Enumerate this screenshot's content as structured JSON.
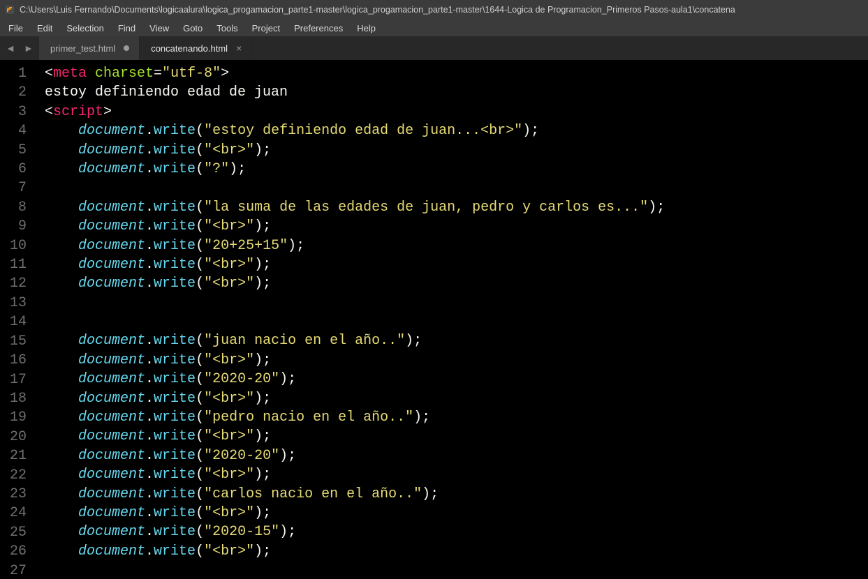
{
  "title_bar": {
    "path": "C:\\Users\\Luis Fernando\\Documents\\logicaalura\\logica_progamacion_parte1-master\\logica_progamacion_parte1-master\\1644-Logica de Programacion_Primeros Pasos-aula1\\concatena"
  },
  "menu": [
    "File",
    "Edit",
    "Selection",
    "Find",
    "View",
    "Goto",
    "Tools",
    "Project",
    "Preferences",
    "Help"
  ],
  "nav": {
    "back": "◄",
    "forward": "►"
  },
  "tabs": [
    {
      "label": "primer_test.html",
      "dirty": true,
      "active": false
    },
    {
      "label": "concatenando.html",
      "dirty": false,
      "active": true
    }
  ],
  "code_lines": [
    {
      "n": 1,
      "indent": 0,
      "segs": [
        {
          "t": "<",
          "c": "angle"
        },
        {
          "t": "meta ",
          "c": "tag"
        },
        {
          "t": "charset",
          "c": "attr"
        },
        {
          "t": "=",
          "c": "punct"
        },
        {
          "t": "\"utf-8\"",
          "c": "str"
        },
        {
          "t": ">",
          "c": "angle"
        }
      ]
    },
    {
      "n": 2,
      "indent": 0,
      "segs": [
        {
          "t": "estoy definiendo edad de juan",
          "c": "plain"
        }
      ]
    },
    {
      "n": 3,
      "indent": 0,
      "segs": [
        {
          "t": "<",
          "c": "angle"
        },
        {
          "t": "script",
          "c": "tag"
        },
        {
          "t": ">",
          "c": "angle"
        }
      ]
    },
    {
      "n": 4,
      "indent": 1,
      "segs": [
        {
          "t": "document",
          "c": "obj"
        },
        {
          "t": ".",
          "c": "dot"
        },
        {
          "t": "write",
          "c": "method"
        },
        {
          "t": "(",
          "c": "punct"
        },
        {
          "t": "\"estoy definiendo edad de juan...<br>\"",
          "c": "str"
        },
        {
          "t": ")",
          "c": "punct"
        },
        {
          "t": ";",
          "c": "semi"
        }
      ]
    },
    {
      "n": 5,
      "indent": 1,
      "segs": [
        {
          "t": "document",
          "c": "obj"
        },
        {
          "t": ".",
          "c": "dot"
        },
        {
          "t": "write",
          "c": "method"
        },
        {
          "t": "(",
          "c": "punct"
        },
        {
          "t": "\"<br>\"",
          "c": "str"
        },
        {
          "t": ")",
          "c": "punct"
        },
        {
          "t": ";",
          "c": "semi"
        }
      ]
    },
    {
      "n": 6,
      "indent": 1,
      "segs": [
        {
          "t": "document",
          "c": "obj"
        },
        {
          "t": ".",
          "c": "dot"
        },
        {
          "t": "write",
          "c": "method"
        },
        {
          "t": "(",
          "c": "punct"
        },
        {
          "t": "\"?\"",
          "c": "str"
        },
        {
          "t": ")",
          "c": "punct"
        },
        {
          "t": ";",
          "c": "semi"
        }
      ]
    },
    {
      "n": 7,
      "indent": 1,
      "segs": []
    },
    {
      "n": 8,
      "indent": 1,
      "segs": [
        {
          "t": "document",
          "c": "obj"
        },
        {
          "t": ".",
          "c": "dot"
        },
        {
          "t": "write",
          "c": "method"
        },
        {
          "t": "(",
          "c": "punct"
        },
        {
          "t": "\"la suma de las edades de juan, pedro y carlos es...\"",
          "c": "str"
        },
        {
          "t": ")",
          "c": "punct"
        },
        {
          "t": ";",
          "c": "semi"
        }
      ]
    },
    {
      "n": 9,
      "indent": 1,
      "segs": [
        {
          "t": "document",
          "c": "obj"
        },
        {
          "t": ".",
          "c": "dot"
        },
        {
          "t": "write",
          "c": "method"
        },
        {
          "t": "(",
          "c": "punct"
        },
        {
          "t": "\"<br>\"",
          "c": "str"
        },
        {
          "t": ")",
          "c": "punct"
        },
        {
          "t": ";",
          "c": "semi"
        }
      ]
    },
    {
      "n": 10,
      "indent": 1,
      "segs": [
        {
          "t": "document",
          "c": "obj"
        },
        {
          "t": ".",
          "c": "dot"
        },
        {
          "t": "write",
          "c": "method"
        },
        {
          "t": "(",
          "c": "punct"
        },
        {
          "t": "\"20+25+15\"",
          "c": "str"
        },
        {
          "t": ")",
          "c": "punct"
        },
        {
          "t": ";",
          "c": "semi"
        }
      ]
    },
    {
      "n": 11,
      "indent": 1,
      "segs": [
        {
          "t": "document",
          "c": "obj"
        },
        {
          "t": ".",
          "c": "dot"
        },
        {
          "t": "write",
          "c": "method"
        },
        {
          "t": "(",
          "c": "punct"
        },
        {
          "t": "\"<br>\"",
          "c": "str"
        },
        {
          "t": ")",
          "c": "punct"
        },
        {
          "t": ";",
          "c": "semi"
        }
      ]
    },
    {
      "n": 12,
      "indent": 1,
      "segs": [
        {
          "t": "document",
          "c": "obj"
        },
        {
          "t": ".",
          "c": "dot"
        },
        {
          "t": "write",
          "c": "method"
        },
        {
          "t": "(",
          "c": "punct"
        },
        {
          "t": "\"<br>\"",
          "c": "str"
        },
        {
          "t": ")",
          "c": "punct"
        },
        {
          "t": ";",
          "c": "semi"
        }
      ]
    },
    {
      "n": 13,
      "indent": 1,
      "segs": []
    },
    {
      "n": 14,
      "indent": 1,
      "segs": []
    },
    {
      "n": 15,
      "indent": 1,
      "segs": [
        {
          "t": "document",
          "c": "obj"
        },
        {
          "t": ".",
          "c": "dot"
        },
        {
          "t": "write",
          "c": "method"
        },
        {
          "t": "(",
          "c": "punct"
        },
        {
          "t": "\"juan nacio en el año..\"",
          "c": "str"
        },
        {
          "t": ")",
          "c": "punct"
        },
        {
          "t": ";",
          "c": "semi"
        }
      ]
    },
    {
      "n": 16,
      "indent": 1,
      "segs": [
        {
          "t": "document",
          "c": "obj"
        },
        {
          "t": ".",
          "c": "dot"
        },
        {
          "t": "write",
          "c": "method"
        },
        {
          "t": "(",
          "c": "punct"
        },
        {
          "t": "\"<br>\"",
          "c": "str"
        },
        {
          "t": ")",
          "c": "punct"
        },
        {
          "t": ";",
          "c": "semi"
        }
      ]
    },
    {
      "n": 17,
      "indent": 1,
      "segs": [
        {
          "t": "document",
          "c": "obj"
        },
        {
          "t": ".",
          "c": "dot"
        },
        {
          "t": "write",
          "c": "method"
        },
        {
          "t": "(",
          "c": "punct"
        },
        {
          "t": "\"2020-20\"",
          "c": "str"
        },
        {
          "t": ")",
          "c": "punct"
        },
        {
          "t": ";",
          "c": "semi"
        }
      ]
    },
    {
      "n": 18,
      "indent": 1,
      "segs": [
        {
          "t": "document",
          "c": "obj"
        },
        {
          "t": ".",
          "c": "dot"
        },
        {
          "t": "write",
          "c": "method"
        },
        {
          "t": "(",
          "c": "punct"
        },
        {
          "t": "\"<br>\"",
          "c": "str"
        },
        {
          "t": ")",
          "c": "punct"
        },
        {
          "t": ";",
          "c": "semi"
        }
      ]
    },
    {
      "n": 19,
      "indent": 1,
      "segs": [
        {
          "t": "document",
          "c": "obj"
        },
        {
          "t": ".",
          "c": "dot"
        },
        {
          "t": "write",
          "c": "method"
        },
        {
          "t": "(",
          "c": "punct"
        },
        {
          "t": "\"pedro nacio en el año..\"",
          "c": "str"
        },
        {
          "t": ")",
          "c": "punct"
        },
        {
          "t": ";",
          "c": "semi"
        }
      ]
    },
    {
      "n": 20,
      "indent": 1,
      "segs": [
        {
          "t": "document",
          "c": "obj"
        },
        {
          "t": ".",
          "c": "dot"
        },
        {
          "t": "write",
          "c": "method"
        },
        {
          "t": "(",
          "c": "punct"
        },
        {
          "t": "\"<br>\"",
          "c": "str"
        },
        {
          "t": ")",
          "c": "punct"
        },
        {
          "t": ";",
          "c": "semi"
        }
      ]
    },
    {
      "n": 21,
      "indent": 1,
      "segs": [
        {
          "t": "document",
          "c": "obj"
        },
        {
          "t": ".",
          "c": "dot"
        },
        {
          "t": "write",
          "c": "method"
        },
        {
          "t": "(",
          "c": "punct"
        },
        {
          "t": "\"2020-20\"",
          "c": "str"
        },
        {
          "t": ")",
          "c": "punct"
        },
        {
          "t": ";",
          "c": "semi"
        }
      ]
    },
    {
      "n": 22,
      "indent": 1,
      "segs": [
        {
          "t": "document",
          "c": "obj"
        },
        {
          "t": ".",
          "c": "dot"
        },
        {
          "t": "write",
          "c": "method"
        },
        {
          "t": "(",
          "c": "punct"
        },
        {
          "t": "\"<br>\"",
          "c": "str"
        },
        {
          "t": ")",
          "c": "punct"
        },
        {
          "t": ";",
          "c": "semi"
        }
      ]
    },
    {
      "n": 23,
      "indent": 1,
      "segs": [
        {
          "t": "document",
          "c": "obj"
        },
        {
          "t": ".",
          "c": "dot"
        },
        {
          "t": "write",
          "c": "method"
        },
        {
          "t": "(",
          "c": "punct"
        },
        {
          "t": "\"carlos nacio en el año..\"",
          "c": "str"
        },
        {
          "t": ")",
          "c": "punct"
        },
        {
          "t": ";",
          "c": "semi"
        }
      ]
    },
    {
      "n": 24,
      "indent": 1,
      "segs": [
        {
          "t": "document",
          "c": "obj"
        },
        {
          "t": ".",
          "c": "dot"
        },
        {
          "t": "write",
          "c": "method"
        },
        {
          "t": "(",
          "c": "punct"
        },
        {
          "t": "\"<br>\"",
          "c": "str"
        },
        {
          "t": ")",
          "c": "punct"
        },
        {
          "t": ";",
          "c": "semi"
        }
      ]
    },
    {
      "n": 25,
      "indent": 1,
      "segs": [
        {
          "t": "document",
          "c": "obj"
        },
        {
          "t": ".",
          "c": "dot"
        },
        {
          "t": "write",
          "c": "method"
        },
        {
          "t": "(",
          "c": "punct"
        },
        {
          "t": "\"2020-15\"",
          "c": "str"
        },
        {
          "t": ")",
          "c": "punct"
        },
        {
          "t": ";",
          "c": "semi"
        }
      ]
    },
    {
      "n": 26,
      "indent": 1,
      "segs": [
        {
          "t": "document",
          "c": "obj"
        },
        {
          "t": ".",
          "c": "dot"
        },
        {
          "t": "write",
          "c": "method"
        },
        {
          "t": "(",
          "c": "punct"
        },
        {
          "t": "\"<br>\"",
          "c": "str"
        },
        {
          "t": ")",
          "c": "punct"
        },
        {
          "t": ";",
          "c": "semi"
        }
      ]
    },
    {
      "n": 27,
      "indent": 1,
      "segs": []
    }
  ]
}
